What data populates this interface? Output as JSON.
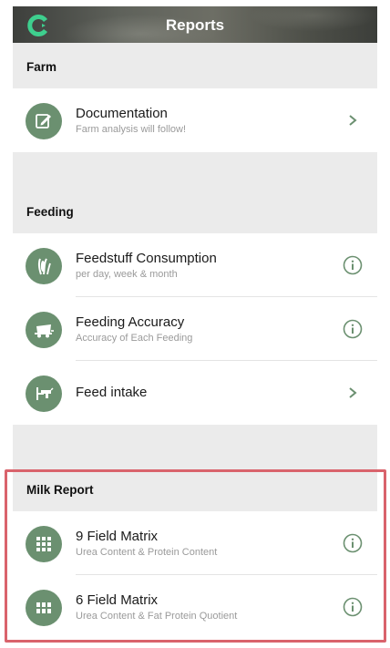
{
  "header": {
    "title": "Reports",
    "logo": "app-logo-icon"
  },
  "sections": [
    {
      "title": "Farm",
      "items": [
        {
          "title": "Documentation",
          "subtitle": "Farm analysis will follow!",
          "icon": "edit-document-icon",
          "trailing": "chevron-right"
        }
      ]
    },
    {
      "title": "Feeding",
      "items": [
        {
          "title": "Feedstuff Consumption",
          "subtitle": "per day, week & month",
          "icon": "corn-icon",
          "trailing": "info"
        },
        {
          "title": "Feeding Accuracy",
          "subtitle": "Accuracy of Each Feeding",
          "icon": "feed-wagon-icon",
          "trailing": "info"
        },
        {
          "title": "Feed intake",
          "subtitle": "",
          "icon": "cow-feeding-icon",
          "trailing": "chevron-right"
        }
      ]
    },
    {
      "title": "Milk Report",
      "items": [
        {
          "title": "9 Field Matrix",
          "subtitle": "Urea Content & Protein Content",
          "icon": "grid-9-icon",
          "trailing": "info"
        },
        {
          "title": "6 Field Matrix",
          "subtitle": "Urea Content & Fat Protein Quotient",
          "icon": "grid-6-icon",
          "trailing": "info"
        }
      ]
    }
  ],
  "colors": {
    "accent": "#6b9070",
    "section_bg": "#ebebeb",
    "highlight": "#d9636c",
    "logo": "#3ecf8e"
  }
}
